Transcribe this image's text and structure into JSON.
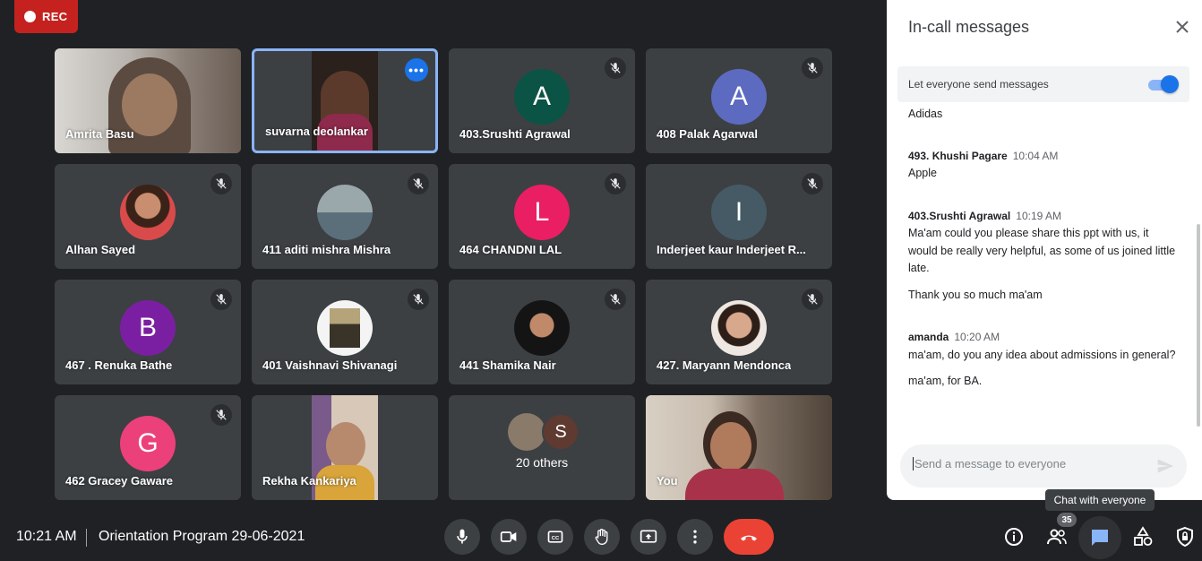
{
  "recording": {
    "label": "REC"
  },
  "tiles": [
    {
      "name": "Amrita Basu"
    },
    {
      "name": "suvarna deolankar"
    },
    {
      "name": "403.Srushti Agrawal",
      "initial": "A"
    },
    {
      "name": "408 Palak Agarwal",
      "initial": "A"
    },
    {
      "name": "Alhan Sayed"
    },
    {
      "name": "411 aditi mishra Mishra"
    },
    {
      "name": "464 CHANDNI LAL",
      "initial": "L"
    },
    {
      "name": "Inderjeet kaur Inderjeet R..."
    },
    {
      "name": "467 . Renuka Bathe",
      "initial": "B"
    },
    {
      "name": "401 Vaishnavi Shivanagi"
    },
    {
      "name": "441 Shamika Nair"
    },
    {
      "name": "427. Maryann Mendonca"
    },
    {
      "name": "462 Gracey Gaware",
      "initial": "G"
    },
    {
      "name": "Rekha Kankariya"
    },
    {
      "name": "20 others",
      "initial": "S"
    },
    {
      "name": "You"
    }
  ],
  "inderjeet_initial": "I",
  "tile_colors": {
    "srushti": "#0b5345",
    "palak": "#5c6bc0",
    "chandni": "#e91e63",
    "inderjeet": "#455a64",
    "renuka": "#7b1fa2",
    "gracey": "#ec407a",
    "others_s": "#5d4037"
  },
  "panel": {
    "title": "In-call messages",
    "toggle_label": "Let everyone send messages",
    "first_line": "Adidas",
    "messages": [
      {
        "sender": "493. Khushi Pagare",
        "time": "10:04 AM",
        "lines": [
          "Apple"
        ]
      },
      {
        "sender": "403.Srushti Agrawal",
        "time": "10:19 AM",
        "lines": [
          "Ma'am could you please share this ppt with us, it would be really very helpful, as some of us joined little late.",
          "Thank you so much ma'am"
        ]
      },
      {
        "sender": "amanda",
        "time": "10:20 AM",
        "lines": [
          "ma'am, do you any idea about admissions in general?",
          "ma'am, for BA."
        ]
      }
    ],
    "input_placeholder": "Send a message to everyone"
  },
  "bottom_bar": {
    "time": "10:21 AM",
    "meeting_title": "Orientation Program 29-06-2021",
    "participant_count": "35",
    "tooltip": "Chat with everyone"
  },
  "icons": {
    "controls": [
      "mic-icon",
      "camera-icon",
      "captions-icon",
      "raise-hand-icon",
      "present-icon",
      "more-options-icon",
      "end-call-icon"
    ],
    "right": [
      "info-icon",
      "people-icon",
      "chat-icon",
      "activities-icon",
      "host-controls-icon"
    ]
  }
}
